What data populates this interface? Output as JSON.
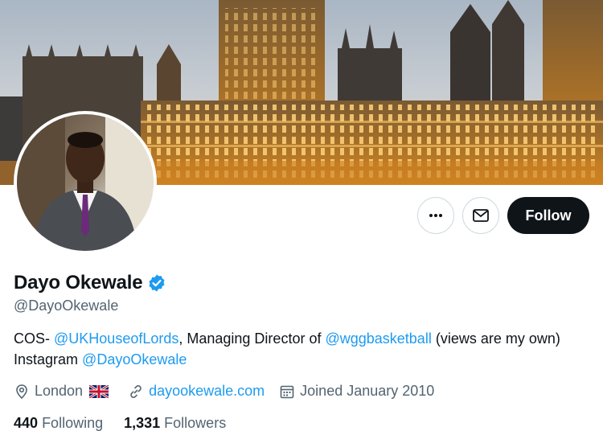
{
  "profile": {
    "name": "Dayo Okewale",
    "handle": "@DayoOkewale",
    "bio": {
      "prefix": "COS- ",
      "mention1": "@UKHouseofLords",
      "middle": ", Managing Director of ",
      "mention2": "@wggbasketball",
      "suffix": " (views are my own)",
      "line2_prefix": "Instagram ",
      "mention3": "@DayoOkewale"
    },
    "location": "London",
    "website": "dayookewale.com",
    "joined": "Joined January 2010",
    "following_count": "440",
    "following_label": "Following",
    "followers_count": "1,331",
    "followers_label": "Followers"
  },
  "actions": {
    "more_icon": "more-icon",
    "message_icon": "mail-icon",
    "follow_label": "Follow"
  },
  "colors": {
    "accent": "#1d9bf0",
    "text": "#0f1419",
    "secondary": "#536471",
    "follow_bg": "#0f1419"
  }
}
